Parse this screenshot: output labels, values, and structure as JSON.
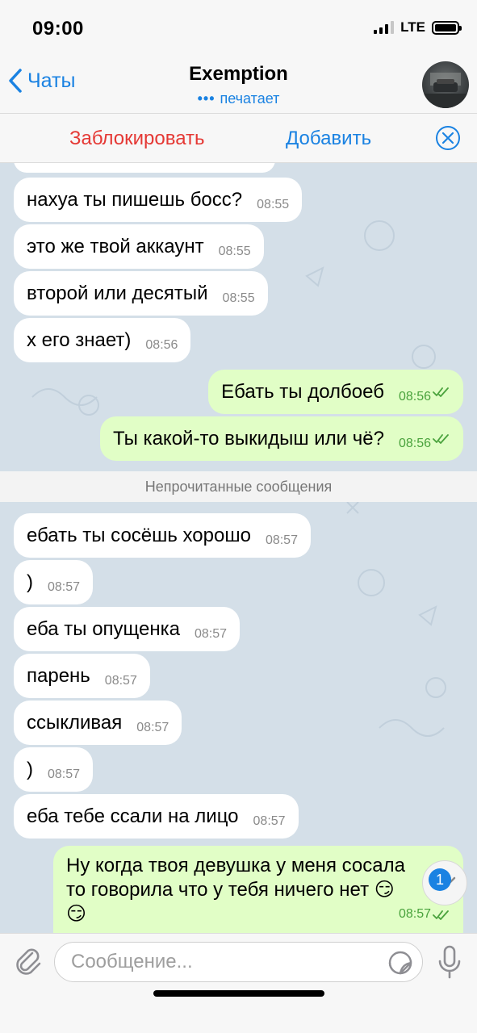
{
  "status_bar": {
    "time": "09:00",
    "network": "LTE"
  },
  "nav": {
    "back_label": "Чаты",
    "title": "Exemption",
    "status_dots": "•••",
    "status": "печатает"
  },
  "actions": {
    "block": "Заблокировать",
    "add": "Добавить"
  },
  "chat": {
    "unread_divider": "Непрочитанные сообщения",
    "messages": [
      {
        "text": "нахуа ты пишешь босс?",
        "time": "08:55"
      },
      {
        "text": "это же твой аккаунт",
        "time": "08:55"
      },
      {
        "text": "второй или десятый",
        "time": "08:55"
      },
      {
        "text": "х его знает)",
        "time": "08:56"
      },
      {
        "text": "Ебать ты долбоеб",
        "time": "08:56"
      },
      {
        "text": "Ты какой-то выкидыш или чё?",
        "time": "08:56"
      },
      {
        "text": "ебать ты сосёшь хорошо",
        "time": "08:57"
      },
      {
        "text": ")",
        "time": "08:57"
      },
      {
        "text": "еба ты опущенка",
        "time": "08:57"
      },
      {
        "text": "парень",
        "time": "08:57"
      },
      {
        "text": "ссыкливая",
        "time": "08:57"
      },
      {
        "text": ")",
        "time": "08:57"
      },
      {
        "text": "еба тебе ссали на лицо",
        "time": "08:57"
      },
      {
        "text_line1": "Ну когда твоя девушка у меня сосала",
        "text_line2": "то говорила что у тебя ничего нет 😏",
        "text_line3": "😏",
        "time": "08:57"
      }
    ],
    "unread_badge": "1"
  },
  "input": {
    "placeholder": "Сообщение..."
  },
  "colors": {
    "accent": "#1a82e2",
    "destructive": "#e53935",
    "outgoing_bubble": "#e1fec6",
    "incoming_bubble": "#ffffff",
    "chat_background": "#d4dfe8"
  }
}
